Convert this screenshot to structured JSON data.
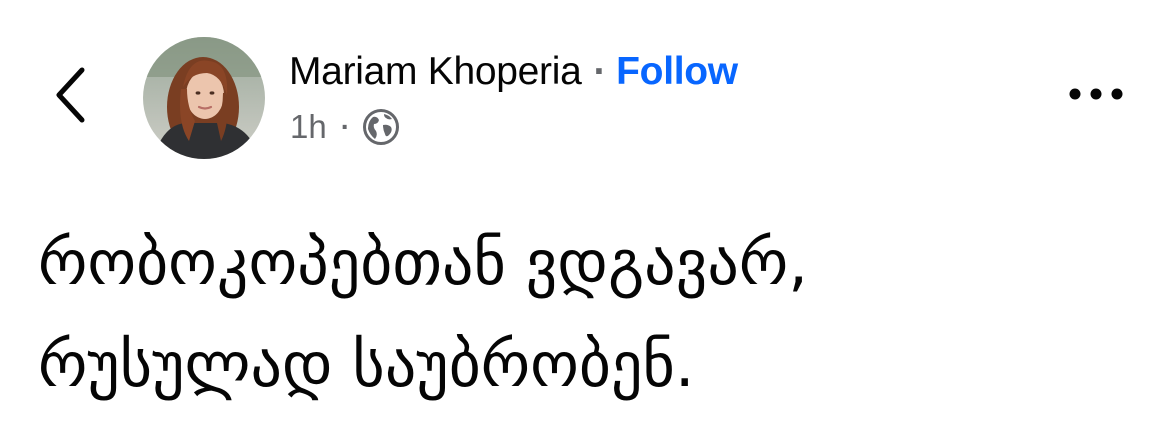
{
  "post": {
    "author": {
      "name": "Mariam Khoperia",
      "separator": "·",
      "follow_label": "Follow"
    },
    "meta": {
      "time": "1h",
      "separator": "·",
      "audience_icon": "globe-icon"
    },
    "text_lines": [
      "რობოკოპებთან ვდგავარ,",
      "რუსულად საუბრობენ."
    ]
  },
  "icons": {
    "back": "chevron-left-icon",
    "more": "more-horizontal-icon"
  },
  "colors": {
    "link": "#0866ff",
    "secondary_text": "#65676b",
    "primary_text": "#050505",
    "background": "#ffffff"
  }
}
